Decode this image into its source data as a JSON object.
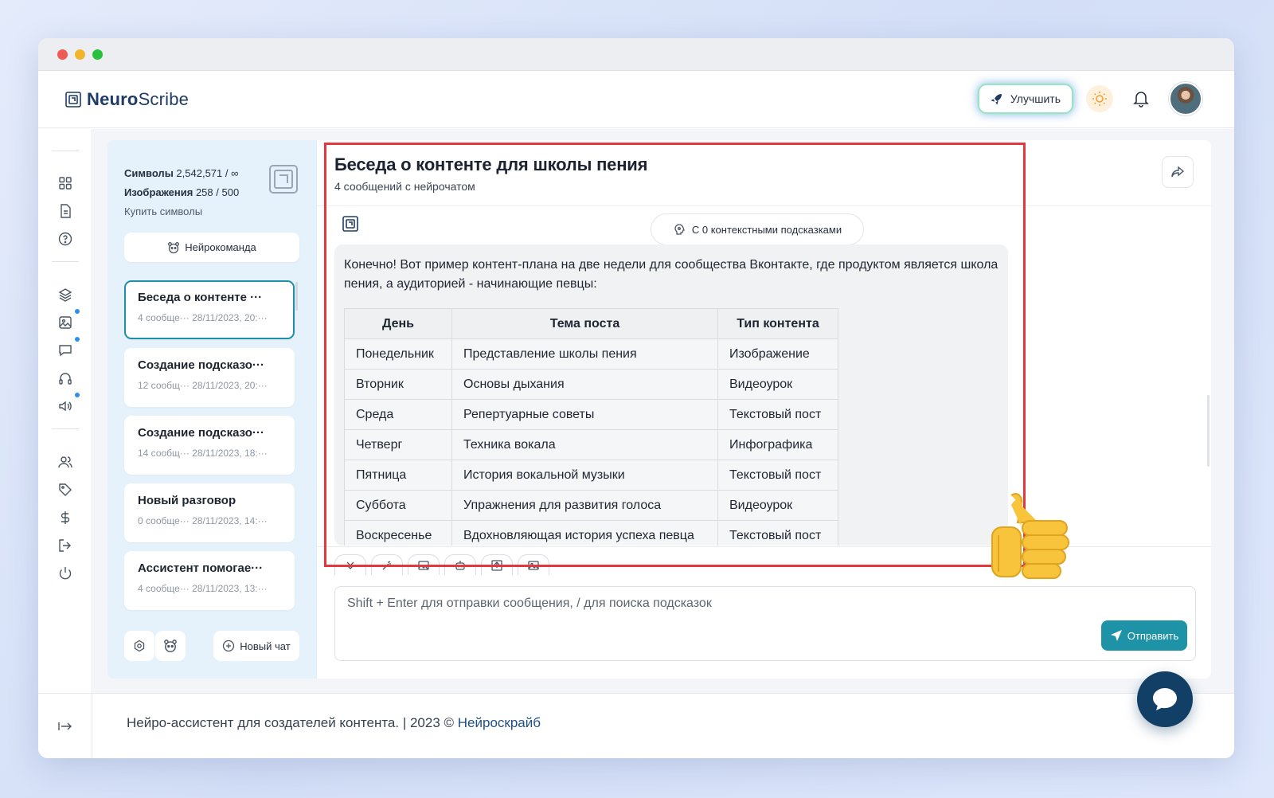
{
  "app": {
    "logo_bold": "Neuro",
    "logo_light": "Scribe",
    "upgrade_label": "Улучшить"
  },
  "icons": {
    "rail": [
      "dashboard-icon",
      "document-icon",
      "help-icon",
      "layers-icon",
      "image-icon",
      "chat-icon",
      "headphones-icon",
      "speaker-icon",
      "users-icon",
      "tag-icon",
      "dollar-icon",
      "logout-icon",
      "power-icon"
    ]
  },
  "sidebar": {
    "symbols_label": "Символы",
    "symbols_value": "2,542,571 / ∞",
    "images_label": "Изображения",
    "images_value": "258 / 500",
    "buy_link": "Купить символы",
    "team_button": "Нейрокоманда",
    "chats": [
      {
        "title": "Беседа о контенте ···",
        "meta": "4 сообще··· 28/11/2023, 20:···"
      },
      {
        "title": "Создание подсказо···",
        "meta": "12 сообщ··· 28/11/2023, 20:···"
      },
      {
        "title": "Создание подсказо···",
        "meta": "14 сообщ··· 28/11/2023, 18:···"
      },
      {
        "title": "Новый разговор",
        "meta": "0 сообще··· 28/11/2023, 14:···"
      },
      {
        "title": "Ассистент помогае···",
        "meta": "4 сообще··· 28/11/2023, 13:···"
      }
    ],
    "new_chat_label": "Новый чат"
  },
  "chat": {
    "title": "Беседа о контенте для школы пения",
    "subtitle": "4 сообщений с нейрочатом",
    "context_pill": "С 0 контекстными подсказками",
    "message_text": "Конечно! Вот пример контент-плана на две недели для сообщества Вконтакте, где продуктом является школа пения, а аудиторией - начинающие певцы:",
    "table": {
      "headers": [
        "День",
        "Тема поста",
        "Тип контента"
      ],
      "rows": [
        [
          "Понедельник",
          "Представление школы пения",
          "Изображение"
        ],
        [
          "Вторник",
          "Основы дыхания",
          "Видеоурок"
        ],
        [
          "Среда",
          "Репертуарные советы",
          "Текстовый пост"
        ],
        [
          "Четверг",
          "Техника вокала",
          "Инфографика"
        ],
        [
          "Пятница",
          "История вокальной музыки",
          "Текстовый пост"
        ],
        [
          "Суббота",
          "Упражнения для развития голоса",
          "Видеоурок"
        ],
        [
          "Воскресенье",
          "Вдохновляющая история успеха певца",
          "Текстовый пост"
        ]
      ]
    },
    "composer_placeholder": "Shift + Enter для отправки сообщения, / для поиска подсказок",
    "send_label": "Отправить"
  },
  "footer": {
    "text": "Нейро-ассистент для создателей контента.  | 2023 © ",
    "link": "Нейроскрайб"
  },
  "colors": {
    "accent": "#1e92a7",
    "brand": "#1f3c66",
    "highlight": "#e5373d",
    "fab": "#113f66"
  }
}
